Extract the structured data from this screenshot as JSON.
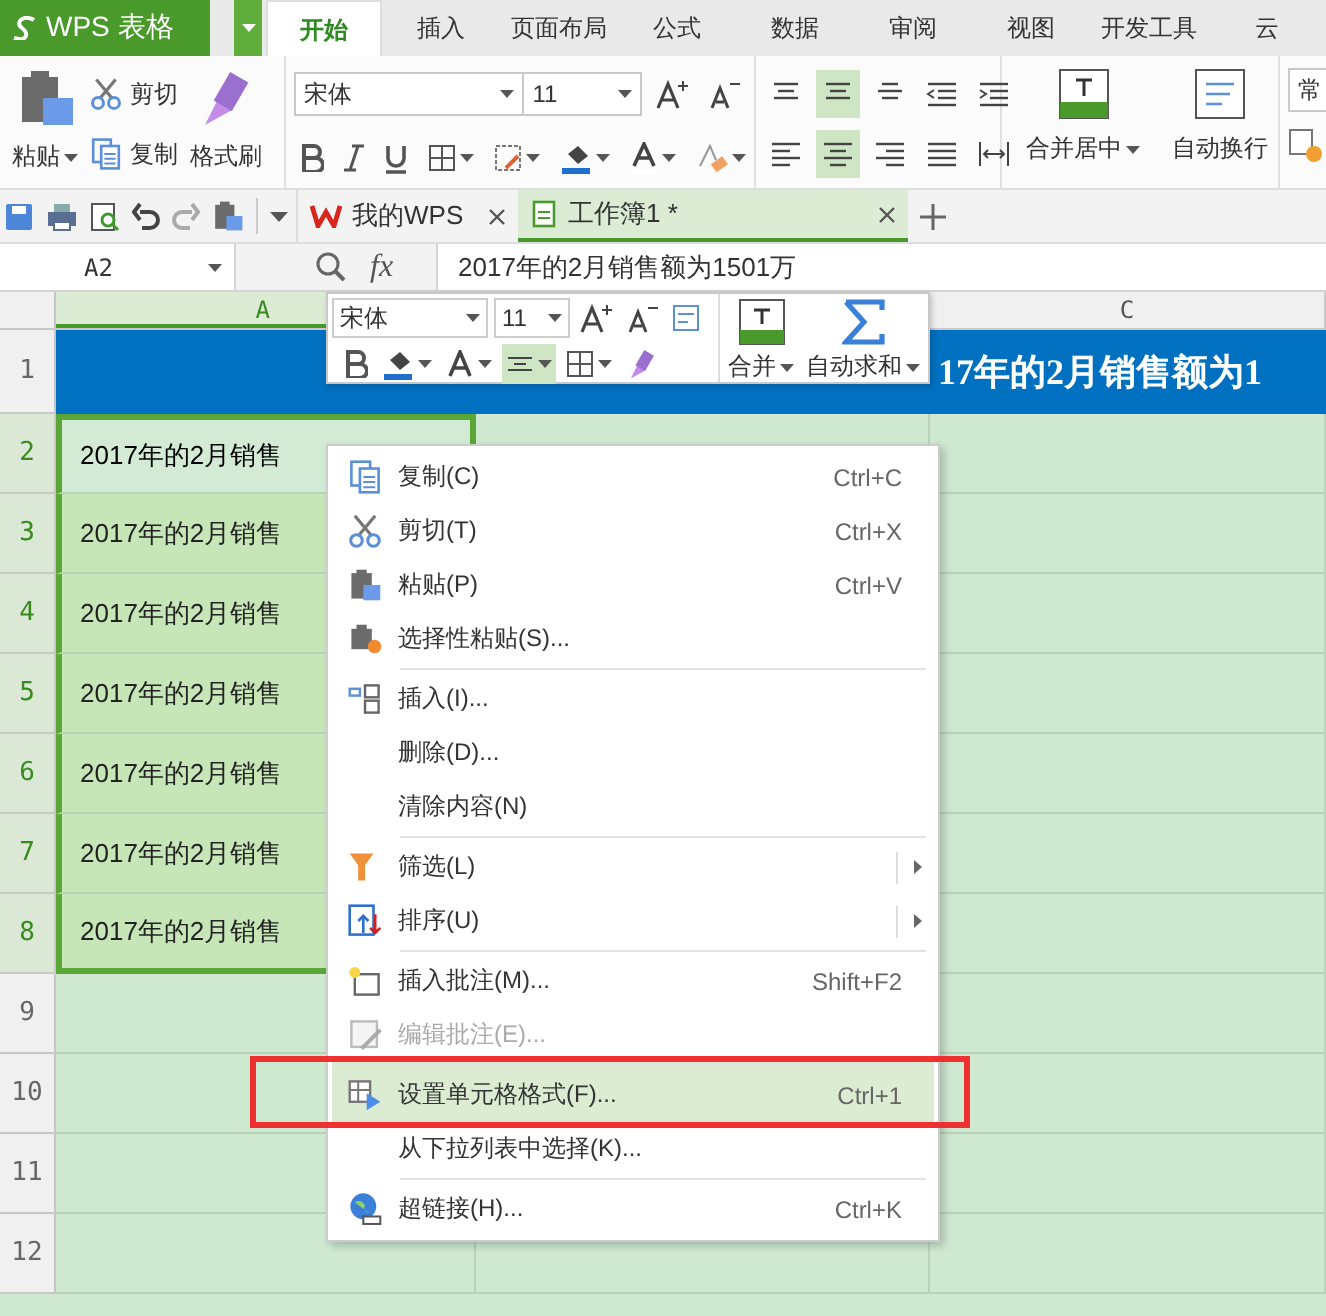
{
  "app": {
    "name": "WPS 表格"
  },
  "menu_tabs": [
    {
      "label": "开始",
      "selected": true
    },
    {
      "label": "插入",
      "selected": false
    },
    {
      "label": "页面布局",
      "selected": false
    },
    {
      "label": "公式",
      "selected": false
    },
    {
      "label": "数据",
      "selected": false
    },
    {
      "label": "审阅",
      "selected": false
    },
    {
      "label": "视图",
      "selected": false
    },
    {
      "label": "开发工具",
      "selected": false
    },
    {
      "label": "云",
      "selected": false
    }
  ],
  "ribbon": {
    "clipboard": [
      {
        "label": "粘贴",
        "kind": "paste"
      },
      {
        "label": "剪切",
        "kind": "cut"
      },
      {
        "label": "复制",
        "kind": "copy"
      },
      {
        "label": "格式刷",
        "kind": "brush"
      }
    ],
    "font": "宋体",
    "font_size": "11",
    "merge_label": "合并居中",
    "wrap_label": "自动换行",
    "number_format": "常"
  },
  "doc_tabs": [
    {
      "label": "我的WPS",
      "kind": "home",
      "selected": false
    },
    {
      "label": "工作簿1 *",
      "kind": "sheet",
      "selected": true
    }
  ],
  "formula_bar": {
    "cell": "A2",
    "fx": "fx",
    "formula": "2017年的2月销售额为1501万"
  },
  "columns": [
    {
      "label": "A",
      "selected": true
    },
    {},
    {
      "label": "C",
      "selected": false
    }
  ],
  "rows": [
    {
      "number": "1",
      "kind": "title",
      "selected": false,
      "text": "17年的2月销售额为1"
    },
    {
      "number": "2",
      "kind": "data",
      "selected": true,
      "text": "2017年的2月销售"
    },
    {
      "number": "3",
      "kind": "data",
      "selected": true,
      "text": "2017年的2月销售"
    },
    {
      "number": "4",
      "kind": "data",
      "selected": true,
      "text": "2017年的2月销售"
    },
    {
      "number": "5",
      "kind": "data",
      "selected": true,
      "text": "2017年的2月销售"
    },
    {
      "number": "6",
      "kind": "data",
      "selected": true,
      "text": "2017年的2月销售"
    },
    {
      "number": "7",
      "kind": "data",
      "selected": true,
      "text": "2017年的2月销售"
    },
    {
      "number": "8",
      "kind": "data",
      "selected": true,
      "text": "2017年的2月销售"
    },
    {
      "number": "9",
      "kind": "empty",
      "selected": false
    },
    {
      "number": "10",
      "kind": "empty",
      "selected": false
    },
    {
      "number": "11",
      "kind": "empty",
      "selected": false
    },
    {
      "number": "12",
      "kind": "empty",
      "selected": false
    }
  ],
  "mini_toolbar": {
    "font": "宋体",
    "font_size": "11",
    "merge_label": "合并",
    "sum_label": "自动求和"
  },
  "context_menu": [
    {
      "label": "复制(C)",
      "shortcut": "Ctrl+C",
      "kind": "copy",
      "separator_before": false,
      "disabled": false,
      "submenu": false,
      "selected": false,
      "outlined": false
    },
    {
      "label": "剪切(T)",
      "shortcut": "Ctrl+X",
      "kind": "cut",
      "separator_before": false,
      "disabled": false,
      "submenu": false,
      "selected": false,
      "outlined": false
    },
    {
      "label": "粘贴(P)",
      "shortcut": "Ctrl+V",
      "kind": "paste",
      "separator_before": false,
      "disabled": false,
      "submenu": false,
      "selected": false,
      "outlined": false
    },
    {
      "label": "选择性粘贴(S)...",
      "kind": "paste-special",
      "separator_before": false,
      "disabled": false,
      "submenu": false,
      "selected": false,
      "outlined": false
    },
    {
      "label": "插入(I)...",
      "kind": "insert",
      "separator_before": true,
      "disabled": false,
      "submenu": false,
      "selected": false,
      "outlined": false
    },
    {
      "label": "删除(D)...",
      "kind": "plain",
      "separator_before": false,
      "disabled": false,
      "submenu": false,
      "selected": false,
      "outlined": false
    },
    {
      "label": "清除内容(N)",
      "kind": "plain",
      "separator_before": false,
      "disabled": false,
      "submenu": false,
      "selected": false,
      "outlined": false
    },
    {
      "label": "筛选(L)",
      "kind": "filter",
      "separator_before": true,
      "disabled": false,
      "submenu": true,
      "selected": false,
      "outlined": false
    },
    {
      "label": "排序(U)",
      "kind": "sort",
      "separator_before": false,
      "disabled": false,
      "submenu": true,
      "selected": false,
      "outlined": false
    },
    {
      "label": "插入批注(M)...",
      "shortcut": "Shift+F2",
      "kind": "comment",
      "separator_before": true,
      "disabled": false,
      "submenu": false,
      "selected": false,
      "outlined": false
    },
    {
      "label": "编辑批注(E)...",
      "kind": "edit-comment",
      "separator_before": false,
      "disabled": true,
      "submenu": false,
      "selected": false,
      "outlined": false
    },
    {
      "label": "设置单元格格式(F)...",
      "shortcut": "Ctrl+1",
      "kind": "format",
      "separator_before": true,
      "disabled": false,
      "submenu": false,
      "selected": true,
      "outlined": true
    },
    {
      "label": "从下拉列表中选择(K)...",
      "kind": "plain",
      "separator_before": false,
      "disabled": false,
      "submenu": false,
      "selected": false,
      "outlined": false
    },
    {
      "label": "超链接(H)...",
      "shortcut": "Ctrl+K",
      "kind": "link",
      "separator_before": true,
      "disabled": false,
      "submenu": false,
      "selected": false,
      "outlined": false
    }
  ]
}
